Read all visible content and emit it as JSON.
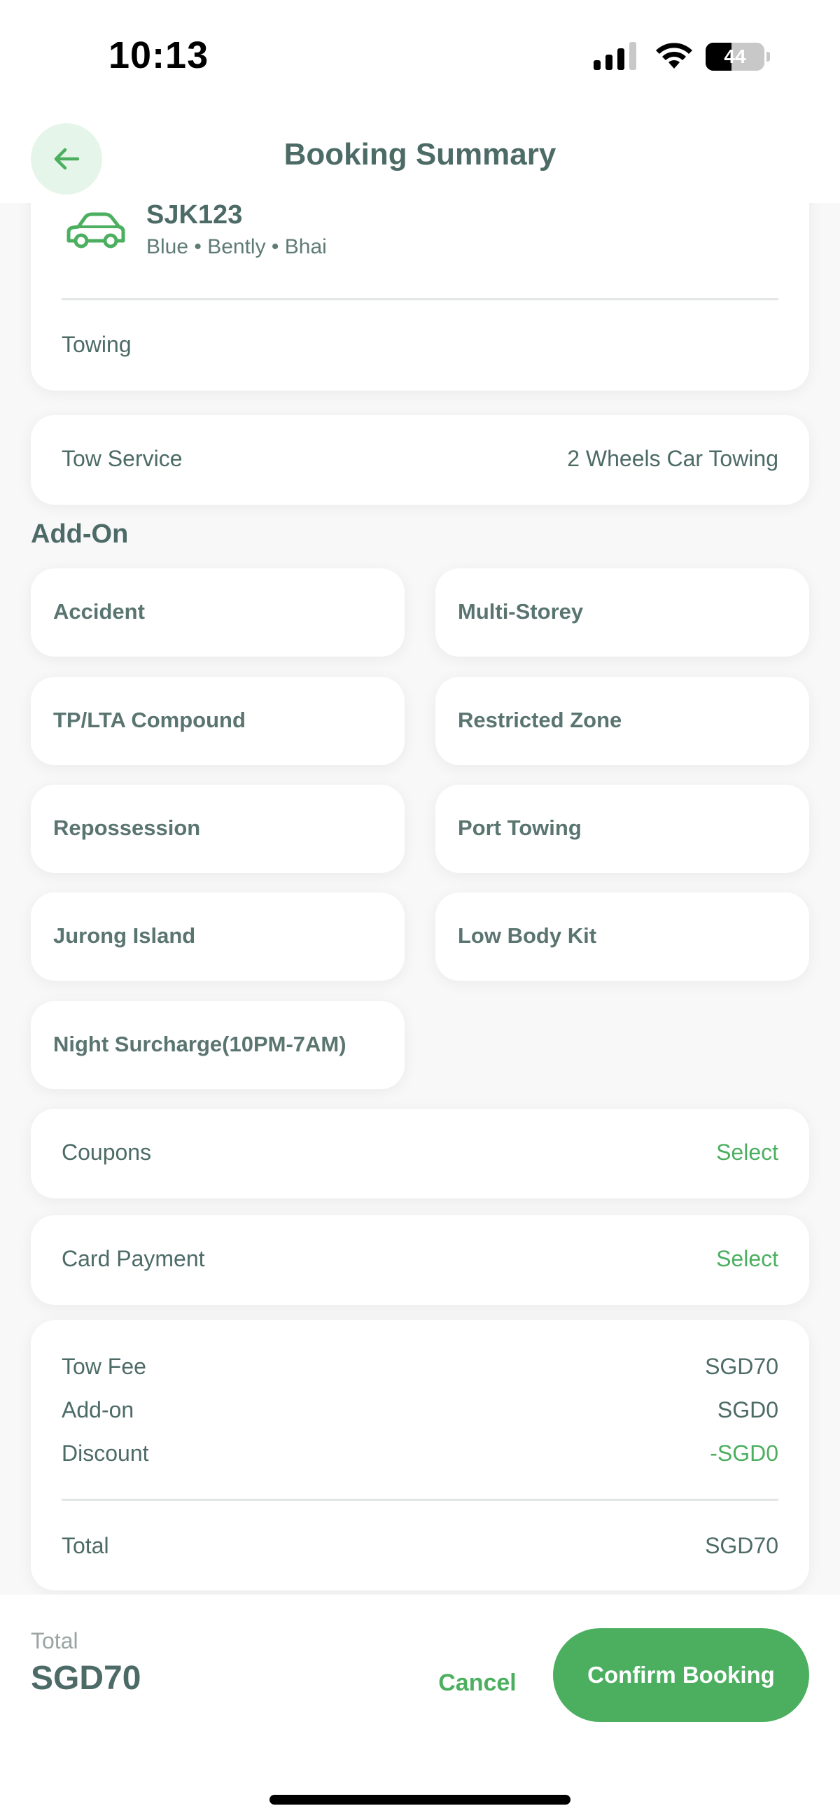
{
  "status_bar": {
    "time": "10:13",
    "battery_level": "44",
    "icons": [
      "signal-icon",
      "wifi-icon",
      "battery-icon"
    ]
  },
  "header": {
    "title": "Booking Summary",
    "back_icon": "arrow-left-icon"
  },
  "vehicle": {
    "icon": "car-icon",
    "plate": "SJK123",
    "description": "Blue • Bently • Bhai",
    "service": "Towing"
  },
  "tow_service": {
    "label": "Tow Service",
    "value": "2 Wheels Car Towing"
  },
  "addons": {
    "title": "Add-On",
    "items": [
      {
        "label": "Accident"
      },
      {
        "label": "Multi-Storey"
      },
      {
        "label": "TP/LTA Compound"
      },
      {
        "label": "Restricted Zone"
      },
      {
        "label": "Repossession"
      },
      {
        "label": "Port Towing"
      },
      {
        "label": "Jurong Island"
      },
      {
        "label": "Low Body Kit"
      },
      {
        "label": "Night Surcharge(10PM-7AM)"
      }
    ]
  },
  "coupons": {
    "label": "Coupons",
    "action": "Select"
  },
  "card_payment": {
    "label": "Card Payment",
    "action": "Select"
  },
  "fees": {
    "tow_fee_label": "Tow Fee",
    "tow_fee_value": "SGD70",
    "addon_label": "Add-on",
    "addon_value": "SGD0",
    "discount_label": "Discount",
    "discount_value": "-SGD0",
    "total_label": "Total",
    "total_value": "SGD70"
  },
  "footer": {
    "total_caption": "Total",
    "total_amount": "SGD70",
    "cancel_label": "Cancel",
    "confirm_label": "Confirm Booking"
  },
  "colors": {
    "accent": "#4caf60",
    "text": "#4d6b66",
    "back_button_bg": "#e6f5e9"
  }
}
